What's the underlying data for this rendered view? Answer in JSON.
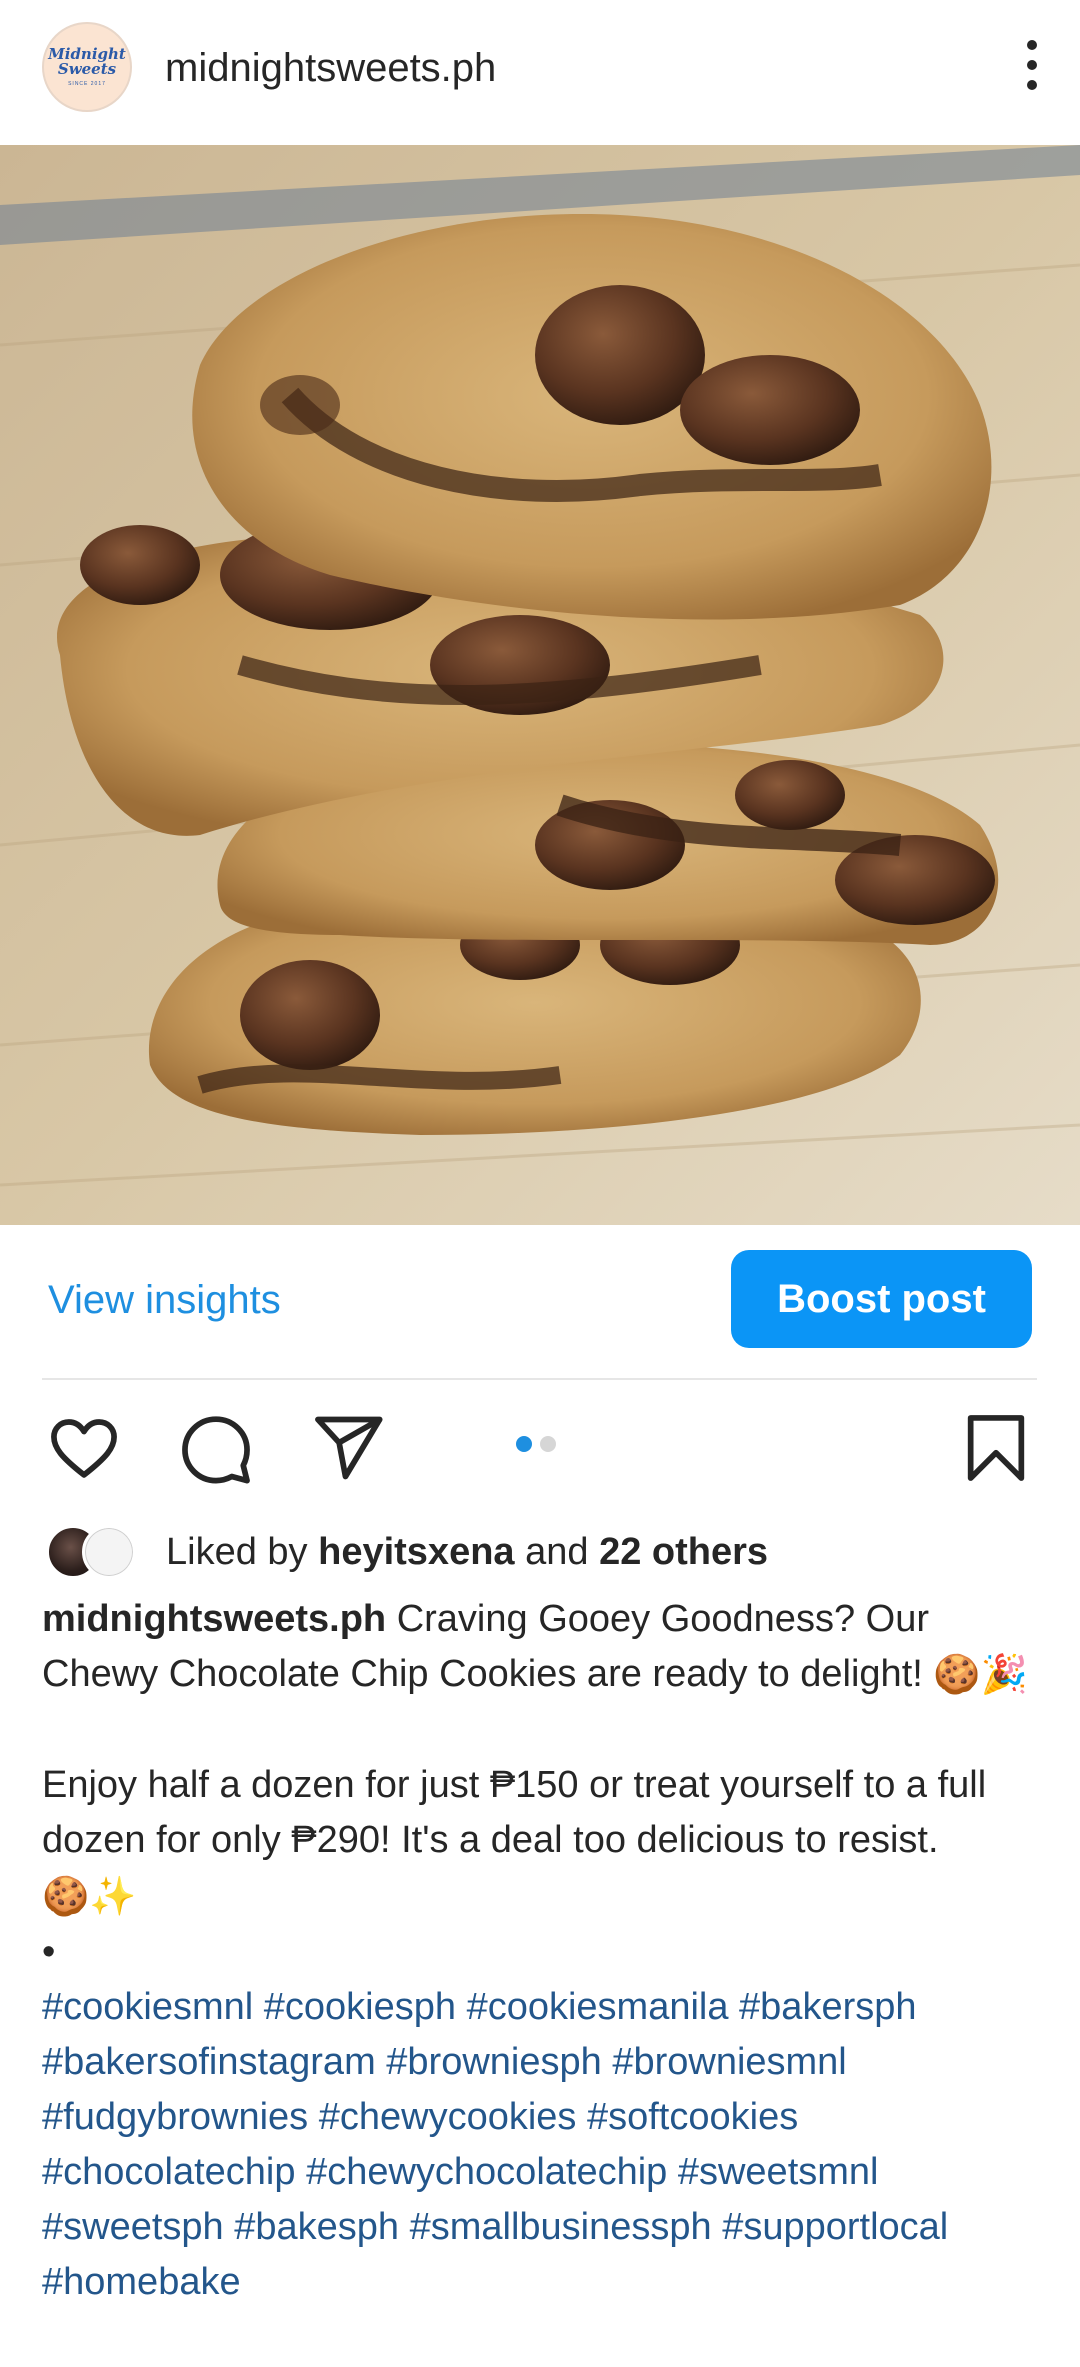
{
  "header": {
    "username": "midnightsweets.ph",
    "avatar_logo_line1": "Midnight",
    "avatar_logo_line2": "Sweets",
    "avatar_logo_sub": "SINCE 2017"
  },
  "post": {
    "image_alt": "Stack of halved chewy chocolate chip cookies on a wooden board",
    "view_insights_label": "View insights",
    "boost_label": "Boost post",
    "carousel": {
      "total": 2,
      "current": 1
    }
  },
  "actions": {
    "like_icon": "heart-icon",
    "comment_icon": "comment-icon",
    "share_icon": "paper-plane-icon",
    "save_icon": "bookmark-icon"
  },
  "likes": {
    "prefix": "Liked by",
    "user": "heyitsxena",
    "middle": "and",
    "others": "22 others"
  },
  "caption": {
    "author": "midnightsweets.ph",
    "line1": "Craving Gooey Goodness? Our Chewy Chocolate Chip Cookies are ready to delight!",
    "line1_emoji": "🍪🎉",
    "line2": "Enjoy half a dozen for just ₱150 or treat yourself to a full dozen for only ₱290! It's a deal too delicious to resist.",
    "line2_emoji": "🍪✨",
    "bullet": "•",
    "hashtags": "#cookiesmnl #cookiesph #cookiesmanila #bakersph #bakersofinstagram #browniesph #browniesmnl #fudgybrownies #chewycookies #softcookies #chocolatechip #chewychocolatechip #sweetsmnl #sweetsph #bakesph #smallbusinessph #supportlocal #homebake"
  },
  "colors": {
    "accent": "#0b95f6",
    "link": "#1e8fe0",
    "hashtag": "#23568b",
    "text": "#262626"
  }
}
